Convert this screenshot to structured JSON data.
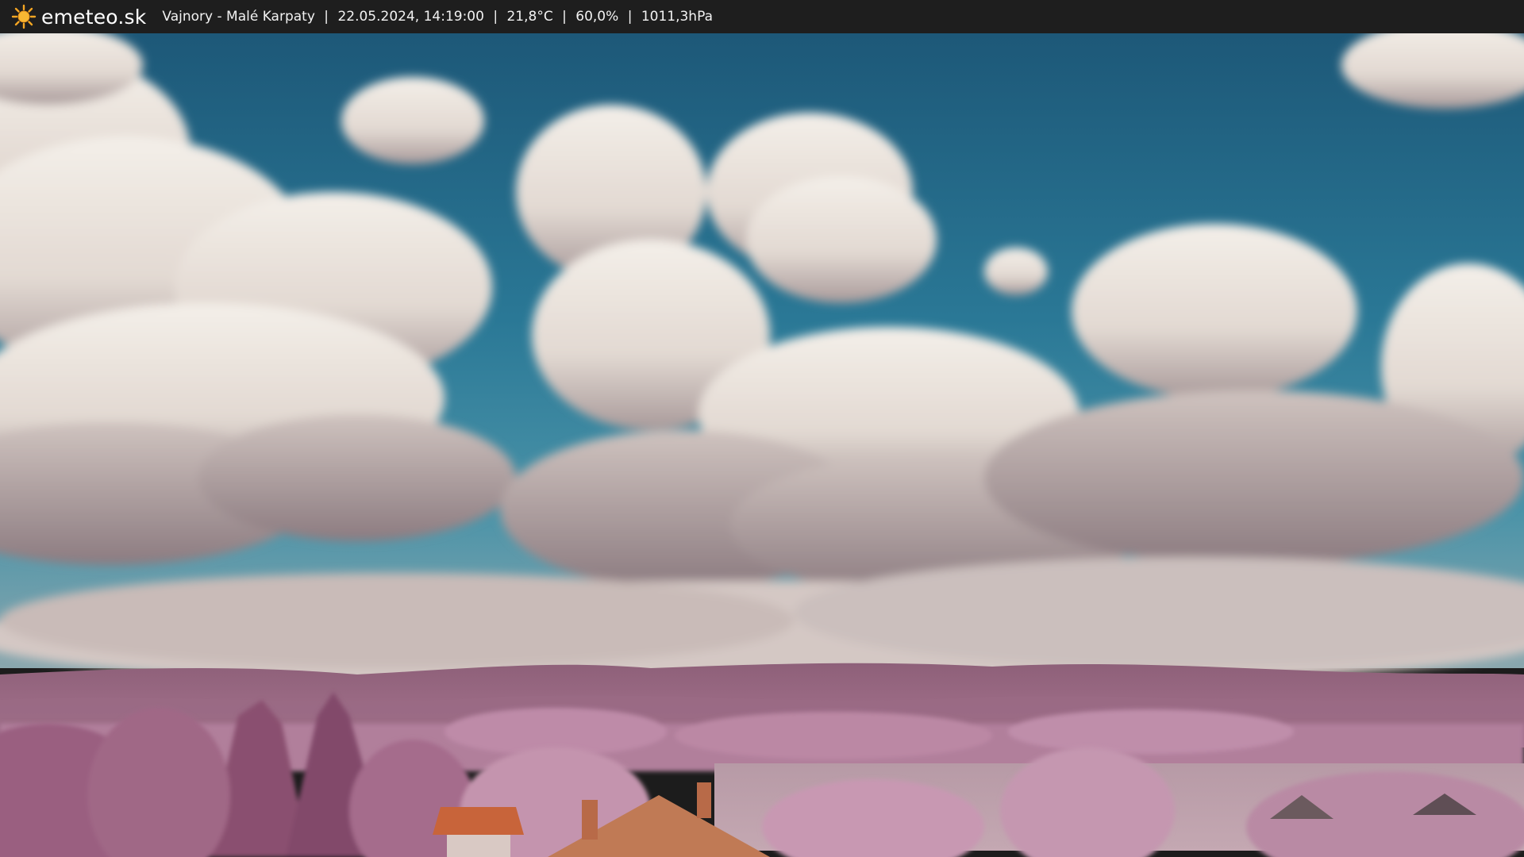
{
  "header": {
    "brand": "emeteo.sk",
    "brand_icon": "sun-icon",
    "location": "Vajnory - Malé Karpaty",
    "datetime": "22.05.2024, 14:19:00",
    "temperature": "21,8°C",
    "humidity": "60,0%",
    "pressure": "1011,3hPa",
    "separator": "|"
  },
  "colors": {
    "bar_background": "#1e1e1e",
    "sun": "#f5a623",
    "sky_top": "#1f5f7f",
    "sky_mid": "#2f7f9f",
    "cloud": "#efe9e2",
    "foliage": "#b07a9a",
    "roof": "#c8643a"
  }
}
